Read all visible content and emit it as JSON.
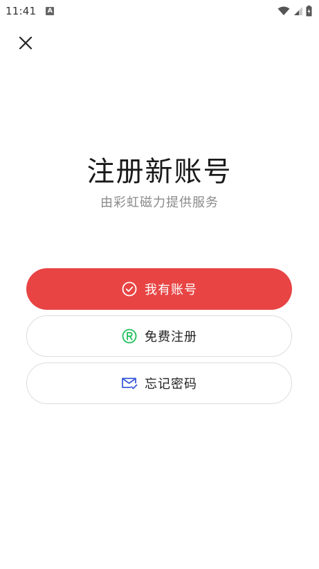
{
  "status_bar": {
    "time": "11:41",
    "a11y_glyph": "A",
    "icons": [
      "wifi-icon",
      "signal-icon",
      "battery-icon"
    ]
  },
  "header": {
    "close_icon": "close-icon"
  },
  "main": {
    "title": "注册新账号",
    "subtitle": "由彩虹磁力提供服务"
  },
  "actions": {
    "login": {
      "label": "我有账号",
      "icon": "check-circle-icon"
    },
    "register": {
      "label": "免费注册",
      "icon": "registered-icon"
    },
    "forgot": {
      "label": "忘记密码",
      "icon": "mail-check-icon"
    }
  },
  "colors": {
    "accent": "#e84444",
    "register_icon": "#1fbf5a",
    "forgot_icon": "#3a5bd9",
    "subtitle": "#8a8a8a"
  }
}
